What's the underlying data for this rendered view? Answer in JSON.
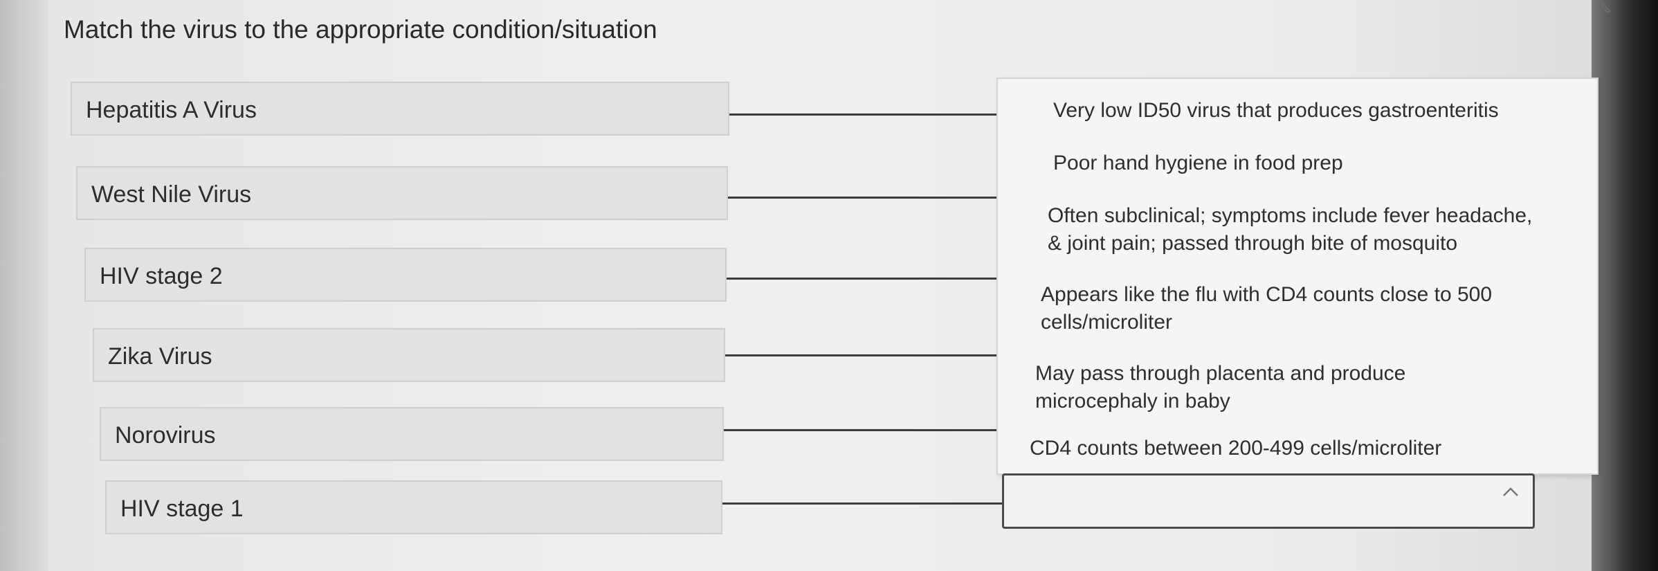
{
  "question": {
    "text": "Match the virus to the appropriate condition/situation"
  },
  "terms": [
    {
      "label": "Hepatitis A Virus"
    },
    {
      "label": "West Nile Virus"
    },
    {
      "label": "HIV stage 2"
    },
    {
      "label": "Zika Virus"
    },
    {
      "label": "Norovirus"
    },
    {
      "label": "HIV stage 1"
    }
  ],
  "options": [
    {
      "line1": "Very low ID50 virus that produces gastroenteritis",
      "line2": ""
    },
    {
      "line1": "Poor hand hygiene in food prep",
      "line2": ""
    },
    {
      "line1": "Often subclinical; symptoms include fever headache,",
      "line2": "& joint pain; passed through bite of mosquito"
    },
    {
      "line1": "Appears like the flu with CD4 counts close to 500",
      "line2": "cells/microliter"
    },
    {
      "line1": "May pass through placenta and produce",
      "line2": "microcephaly in baby"
    },
    {
      "line1": "CD4 counts between 200-499 cells/microliter",
      "line2": ""
    }
  ],
  "select": {
    "value": "",
    "expanded": true
  },
  "icons": {
    "pin": "pin-icon",
    "chevron": "chevron-up-icon"
  },
  "colors": {
    "select_border": "#4a4a4a",
    "term_background": "#e2e2e2"
  }
}
